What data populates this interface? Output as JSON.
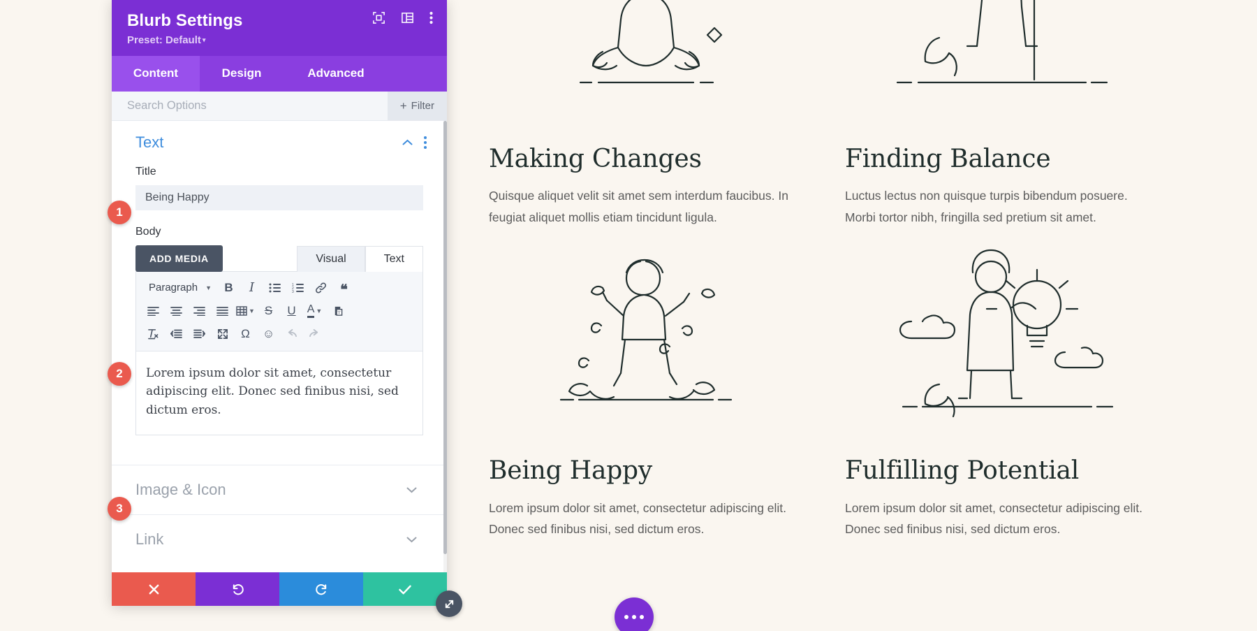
{
  "modal": {
    "title": "Blurb Settings",
    "preset_label": "Preset: Default",
    "preset_caret": "▾",
    "header_icons": [
      {
        "name": "focus-target-icon"
      },
      {
        "name": "layout-columns-icon"
      },
      {
        "name": "kebab-menu-icon"
      }
    ],
    "tabs": [
      {
        "label": "Content",
        "active": true
      },
      {
        "label": "Design",
        "active": false
      },
      {
        "label": "Advanced",
        "active": false
      }
    ],
    "search": {
      "placeholder": "Search Options",
      "value": "",
      "filter_label": "Filter",
      "filter_plus": "+"
    },
    "sections": [
      {
        "title": "Text",
        "state": "expanded",
        "badge": "1"
      },
      {
        "title": "Image & Icon",
        "state": "collapsed",
        "badge": "3"
      },
      {
        "title": "Link",
        "state": "collapsed",
        "badge": ""
      }
    ],
    "fields": {
      "title_label": "Title",
      "title_value": "Being Happy",
      "body_label": "Body"
    },
    "editor": {
      "add_media_label": "ADD MEDIA",
      "mode_tabs": [
        {
          "label": "Visual",
          "active": true
        },
        {
          "label": "Text",
          "active": false
        }
      ],
      "paragraph_label": "Paragraph",
      "toolbar_row1": [
        {
          "name": "bold-icon",
          "glyph": "B"
        },
        {
          "name": "italic-icon",
          "glyph": "I"
        },
        {
          "name": "bulleted-list-icon",
          "glyph": ""
        },
        {
          "name": "numbered-list-icon",
          "glyph": ""
        },
        {
          "name": "link-icon",
          "glyph": ""
        },
        {
          "name": "blockquote-icon",
          "glyph": "❝"
        }
      ],
      "toolbar_row2": [
        {
          "name": "align-left-icon"
        },
        {
          "name": "align-center-icon"
        },
        {
          "name": "align-right-icon"
        },
        {
          "name": "align-justify-icon"
        },
        {
          "name": "table-icon"
        },
        {
          "name": "strikethrough-icon",
          "glyph": "S"
        },
        {
          "name": "underline-icon",
          "glyph": "U"
        },
        {
          "name": "text-color-icon",
          "glyph": "A"
        },
        {
          "name": "paste-as-text-icon"
        }
      ],
      "toolbar_row3": [
        {
          "name": "clear-formatting-icon"
        },
        {
          "name": "outdent-icon"
        },
        {
          "name": "indent-icon"
        },
        {
          "name": "fullscreen-icon"
        },
        {
          "name": "special-character-icon",
          "glyph": "Ω"
        },
        {
          "name": "emoji-icon",
          "glyph": "☺"
        },
        {
          "name": "undo-icon",
          "glyph": "↰",
          "disabled": true
        },
        {
          "name": "redo-icon",
          "glyph": "↱",
          "disabled": true
        }
      ],
      "body_text": "Lorem ipsum dolor sit amet, consectetur adipiscing elit. Donec sed finibus nisi, sed dictum eros."
    },
    "actions": [
      {
        "name": "cancel-button",
        "glyph": "✖",
        "color": "#ea5a4e"
      },
      {
        "name": "undo-button",
        "glyph": "↺",
        "color": "#7b2fd4"
      },
      {
        "name": "redo-button",
        "glyph": "↻",
        "color": "#2b8cdb"
      },
      {
        "name": "save-button",
        "glyph": "✔",
        "color": "#2ec2a0"
      }
    ],
    "badge_color": "#ea5a4e"
  },
  "preview": {
    "background": "#faf6f0",
    "blurbs": [
      {
        "title": "Making Changes",
        "body": "Quisque aliquet velit sit amet sem interdum faucibus. In feugiat aliquet mollis etiam tincidunt ligula.",
        "art": "meditating-person-illustration"
      },
      {
        "title": "Finding Balance",
        "body": "Luctus lectus non quisque turpis bibendum posuere. Morbi tortor nibh, fringilla sed pretium sit amet.",
        "art": "person-balancing-illustration"
      },
      {
        "title": "Being Happy",
        "body": "Lorem ipsum dolor sit amet, consectetur adipiscing elit. Donec sed finibus nisi, sed dictum eros.",
        "art": "happy-jumping-person-illustration"
      },
      {
        "title": "Fulfilling Potential",
        "body": "Lorem ipsum dolor sit amet, consectetur adipiscing elit. Donec sed finibus nisi, sed dictum eros.",
        "art": "person-holding-lightbulb-illustration"
      }
    ],
    "fab": {
      "name": "page-settings-fab",
      "color": "#7b2fd4",
      "dots": 3
    }
  }
}
